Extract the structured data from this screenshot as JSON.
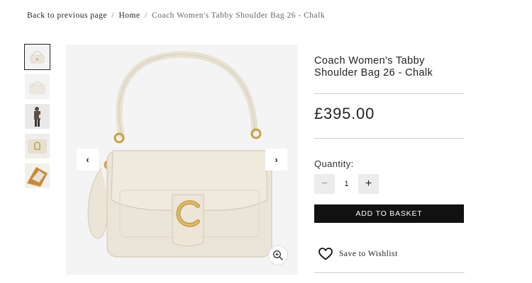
{
  "breadcrumb": {
    "back": "Back to previous page",
    "separator": "/",
    "home": "Home",
    "current": "Coach Women's Tabby Shoulder Bag 26 - Chalk"
  },
  "product": {
    "title": "Coach Women's Tabby Shoulder Bag 26 - Chalk",
    "price": "£395.00"
  },
  "quantity": {
    "label": "Quantity:",
    "value": "1",
    "minus": "−",
    "plus": "+"
  },
  "actions": {
    "add_to_basket": "ADD TO BASKET",
    "wishlist": "Save to Wishlist"
  },
  "gallery": {
    "prev_icon": "chevron-left-icon",
    "next_icon": "chevron-right-icon",
    "zoom_icon": "zoom-in-icon",
    "thumbnail_count": 5,
    "active_thumbnail": 1
  },
  "colors": {
    "bag": "#ece6da",
    "hardware": "#c9a14a",
    "button": "#111111"
  }
}
